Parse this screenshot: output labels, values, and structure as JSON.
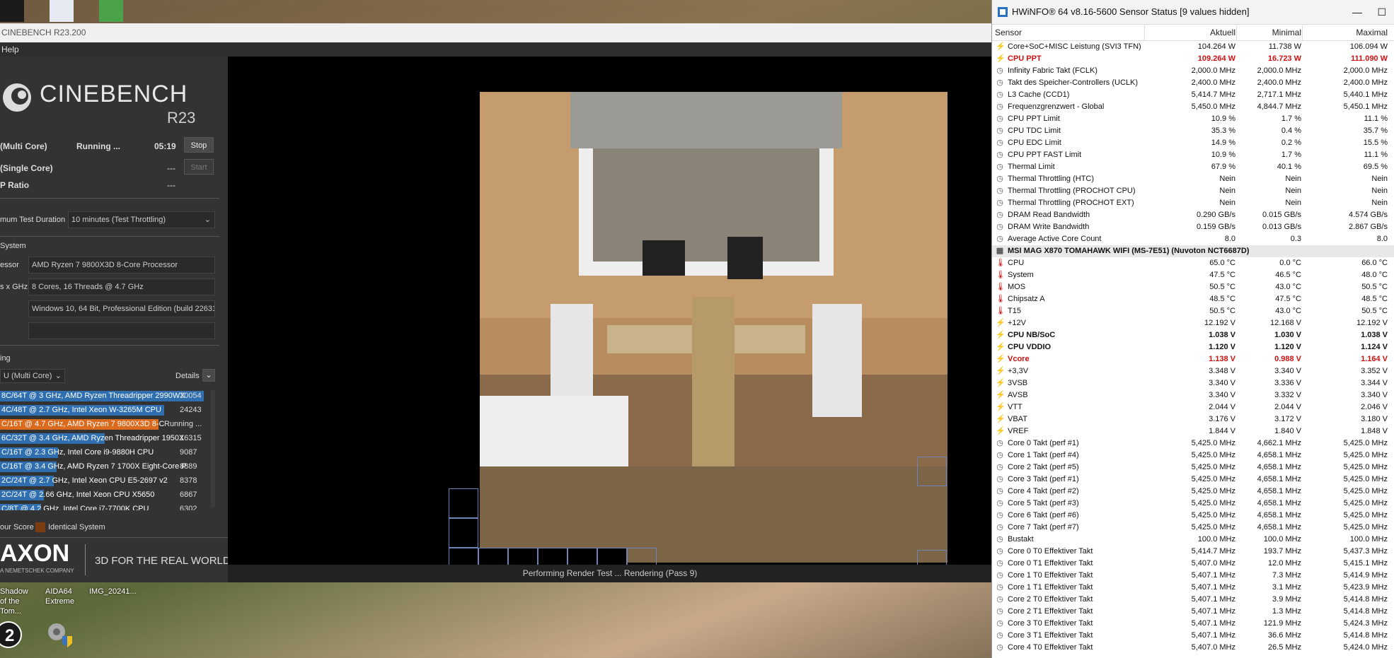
{
  "desktop": {
    "icons": [
      {
        "label": "Shadow of the Tom..."
      },
      {
        "label": "AIDA64 Extreme"
      },
      {
        "label": "IMG_20241..."
      }
    ]
  },
  "cinebench": {
    "title": "CINEBENCH R23.200",
    "menu": {
      "help": "Help"
    },
    "logo": {
      "name": "CINEBENCH",
      "version": "R23"
    },
    "tests": {
      "multi": {
        "label": "(Multi Core)",
        "status": "Running ...",
        "time": "05:19",
        "button": "Stop"
      },
      "single": {
        "label": "(Single Core)",
        "value": "---",
        "button": "Start"
      },
      "ratio": {
        "label": "P Ratio",
        "value": "---"
      }
    },
    "duration": {
      "label": "mum Test Duration",
      "value": "10 minutes (Test Throttling)"
    },
    "system": {
      "heading": "System",
      "processor_label": "essor",
      "processor": "AMD Ryzen 7 9800X3D 8-Core Processor",
      "cores_label": "s x GHz",
      "cores": "8 Cores, 16 Threads @ 4.7 GHz",
      "os": "Windows 10, 64 Bit, Professional Edition (build 22631)",
      "info": ""
    },
    "ranking": {
      "heading": "ing",
      "selector": "U (Multi Core)",
      "details": "Details",
      "rows": [
        {
          "label": "8C/64T @ 3 GHz, AMD Ryzen Threadripper 2990WX",
          "score": "30054",
          "fill": 1.0,
          "type": "other"
        },
        {
          "label": "4C/48T @ 2.7 GHz, Intel Xeon W-3265M CPU",
          "score": "24243",
          "fill": 0.81,
          "type": "other"
        },
        {
          "label": "C/16T @ 4.7 GHz, AMD Ryzen 7 9800X3D 8-C",
          "score": "Running ...",
          "fill": 0.74,
          "type": "mine"
        },
        {
          "label": "6C/32T @ 3.4 GHz, AMD Ryzen Threadripper 1950X",
          "score": "16315",
          "fill": 0.54,
          "type": "other"
        },
        {
          "label": "C/16T @ 2.3 GHz, Intel Core i9-9880H CPU",
          "score": "9087",
          "fill": 0.3,
          "type": "other"
        },
        {
          "label": "C/16T @ 3.4 GHz, AMD Ryzen 7 1700X Eight-Core P",
          "score": "8889",
          "fill": 0.3,
          "type": "other"
        },
        {
          "label": "2C/24T @ 2.7 GHz, Intel Xeon CPU E5-2697 v2",
          "score": "8378",
          "fill": 0.28,
          "type": "other"
        },
        {
          "label": "2C/24T @ 2.66 GHz, Intel Xeon CPU X5650",
          "score": "6867",
          "fill": 0.23,
          "type": "other"
        },
        {
          "label": "C/8T @ 4.2 GHz, Intel Core i7-7700K CPU",
          "score": "6302",
          "fill": 0.21,
          "type": "other"
        }
      ],
      "legend_your": "our Score",
      "legend_identical": "Identical System"
    },
    "footer": {
      "brand": "AXON",
      "sub": "A NEMETSCHEK COMPANY",
      "tagline": "3D FOR THE REAL WORLD"
    },
    "status": "Performing Render Test ... Rendering (Pass 9)"
  },
  "hwinfo": {
    "title": "HWiNFO® 64 v8.16-5600 Sensor Status [9 values hidden]",
    "columns": {
      "sensor": "Sensor",
      "current": "Aktuell",
      "min": "Minimal",
      "max": "Maximal"
    },
    "rows": [
      {
        "icon": "bolt",
        "name": "Core+SoC+MISC Leistung (SVI3 TFN)",
        "v1": "104.264 W",
        "v2": "11.738 W",
        "v3": "106.094 W",
        "style": ""
      },
      {
        "icon": "bolt",
        "name": "CPU PPT",
        "v1": "109.264 W",
        "v2": "16.723 W",
        "v3": "111.090 W",
        "style": "red"
      },
      {
        "icon": "clock",
        "name": "Infinity Fabric Takt (FCLK)",
        "v1": "2,000.0 MHz",
        "v2": "2,000.0 MHz",
        "v3": "2,000.0 MHz",
        "style": ""
      },
      {
        "icon": "clock",
        "name": "Takt des Speicher-Controllers (UCLK)",
        "v1": "2,400.0 MHz",
        "v2": "2,400.0 MHz",
        "v3": "2,400.0 MHz",
        "style": ""
      },
      {
        "icon": "clock",
        "name": "L3 Cache (CCD1)",
        "v1": "5,414.7 MHz",
        "v2": "2,717.1 MHz",
        "v3": "5,440.1 MHz",
        "style": ""
      },
      {
        "icon": "clock",
        "name": "Frequenzgrenzwert - Global",
        "v1": "5,450.0 MHz",
        "v2": "4,844.7 MHz",
        "v3": "5,450.1 MHz",
        "style": ""
      },
      {
        "icon": "clock",
        "name": "CPU PPT Limit",
        "v1": "10.9 %",
        "v2": "1.7 %",
        "v3": "11.1 %",
        "style": ""
      },
      {
        "icon": "clock",
        "name": "CPU TDC Limit",
        "v1": "35.3 %",
        "v2": "0.4 %",
        "v3": "35.7 %",
        "style": ""
      },
      {
        "icon": "clock",
        "name": "CPU EDC Limit",
        "v1": "14.9 %",
        "v2": "0.2 %",
        "v3": "15.5 %",
        "style": ""
      },
      {
        "icon": "clock",
        "name": "CPU PPT FAST Limit",
        "v1": "10.9 %",
        "v2": "1.7 %",
        "v3": "11.1 %",
        "style": ""
      },
      {
        "icon": "clock",
        "name": "Thermal Limit",
        "v1": "67.9 %",
        "v2": "40.1 %",
        "v3": "69.5 %",
        "style": ""
      },
      {
        "icon": "clock",
        "name": "Thermal Throttling (HTC)",
        "v1": "Nein",
        "v2": "Nein",
        "v3": "Nein",
        "style": ""
      },
      {
        "icon": "clock",
        "name": "Thermal Throttling (PROCHOT CPU)",
        "v1": "Nein",
        "v2": "Nein",
        "v3": "Nein",
        "style": ""
      },
      {
        "icon": "clock",
        "name": "Thermal Throttling (PROCHOT EXT)",
        "v1": "Nein",
        "v2": "Nein",
        "v3": "Nein",
        "style": ""
      },
      {
        "icon": "clock",
        "name": "DRAM Read Bandwidth",
        "v1": "0.290 GB/s",
        "v2": "0.015 GB/s",
        "v3": "4.574 GB/s",
        "style": ""
      },
      {
        "icon": "clock",
        "name": "DRAM Write Bandwidth",
        "v1": "0.159 GB/s",
        "v2": "0.013 GB/s",
        "v3": "2.867 GB/s",
        "style": ""
      },
      {
        "icon": "clock",
        "name": "Average Active Core Count",
        "v1": "8.0",
        "v2": "0.3",
        "v3": "8.0",
        "style": ""
      },
      {
        "icon": "chip",
        "name": "MSI MAG X870 TOMAHAWK WIFI (MS-7E51) (Nuvoton NCT6687D)",
        "v1": "",
        "v2": "",
        "v3": "",
        "style": "group"
      },
      {
        "icon": "temp",
        "name": "CPU",
        "v1": "65.0 °C",
        "v2": "0.0 °C",
        "v3": "66.0 °C",
        "style": ""
      },
      {
        "icon": "temp",
        "name": "System",
        "v1": "47.5 °C",
        "v2": "46.5 °C",
        "v3": "48.0 °C",
        "style": ""
      },
      {
        "icon": "temp",
        "name": "MOS",
        "v1": "50.5 °C",
        "v2": "43.0 °C",
        "v3": "50.5 °C",
        "style": ""
      },
      {
        "icon": "temp",
        "name": "Chipsatz A",
        "v1": "48.5 °C",
        "v2": "47.5 °C",
        "v3": "48.5 °C",
        "style": ""
      },
      {
        "icon": "temp",
        "name": "T15",
        "v1": "50.5 °C",
        "v2": "43.0 °C",
        "v3": "50.5 °C",
        "style": ""
      },
      {
        "icon": "bolt",
        "name": "+12V",
        "v1": "12.192 V",
        "v2": "12.168 V",
        "v3": "12.192 V",
        "style": ""
      },
      {
        "icon": "bolt",
        "name": "CPU NB/SoC",
        "v1": "1.038 V",
        "v2": "1.030 V",
        "v3": "1.038 V",
        "style": "bold"
      },
      {
        "icon": "bolt",
        "name": "CPU VDDIO",
        "v1": "1.120 V",
        "v2": "1.120 V",
        "v3": "1.124 V",
        "style": "bold"
      },
      {
        "icon": "bolt",
        "name": "Vcore",
        "v1": "1.138 V",
        "v2": "0.988 V",
        "v3": "1.164 V",
        "style": "red"
      },
      {
        "icon": "bolt",
        "name": "+3,3V",
        "v1": "3.348 V",
        "v2": "3.340 V",
        "v3": "3.352 V",
        "style": ""
      },
      {
        "icon": "bolt",
        "name": "3VSB",
        "v1": "3.340 V",
        "v2": "3.336 V",
        "v3": "3.344 V",
        "style": ""
      },
      {
        "icon": "bolt",
        "name": "AVSB",
        "v1": "3.340 V",
        "v2": "3.332 V",
        "v3": "3.340 V",
        "style": ""
      },
      {
        "icon": "bolt",
        "name": "VTT",
        "v1": "2.044 V",
        "v2": "2.044 V",
        "v3": "2.046 V",
        "style": ""
      },
      {
        "icon": "bolt",
        "name": "VBAT",
        "v1": "3.176 V",
        "v2": "3.172 V",
        "v3": "3.180 V",
        "style": ""
      },
      {
        "icon": "bolt",
        "name": "VREF",
        "v1": "1.844 V",
        "v2": "1.840 V",
        "v3": "1.848 V",
        "style": ""
      },
      {
        "icon": "clock",
        "name": "Core 0 Takt (perf #1)",
        "v1": "5,425.0 MHz",
        "v2": "4,662.1 MHz",
        "v3": "5,425.0 MHz",
        "style": ""
      },
      {
        "icon": "clock",
        "name": "Core 1 Takt (perf #4)",
        "v1": "5,425.0 MHz",
        "v2": "4,658.1 MHz",
        "v3": "5,425.0 MHz",
        "style": ""
      },
      {
        "icon": "clock",
        "name": "Core 2 Takt (perf #5)",
        "v1": "5,425.0 MHz",
        "v2": "4,658.1 MHz",
        "v3": "5,425.0 MHz",
        "style": ""
      },
      {
        "icon": "clock",
        "name": "Core 3 Takt (perf #1)",
        "v1": "5,425.0 MHz",
        "v2": "4,658.1 MHz",
        "v3": "5,425.0 MHz",
        "style": ""
      },
      {
        "icon": "clock",
        "name": "Core 4 Takt (perf #2)",
        "v1": "5,425.0 MHz",
        "v2": "4,658.1 MHz",
        "v3": "5,425.0 MHz",
        "style": ""
      },
      {
        "icon": "clock",
        "name": "Core 5 Takt (perf #3)",
        "v1": "5,425.0 MHz",
        "v2": "4,658.1 MHz",
        "v3": "5,425.0 MHz",
        "style": ""
      },
      {
        "icon": "clock",
        "name": "Core 6 Takt (perf #6)",
        "v1": "5,425.0 MHz",
        "v2": "4,658.1 MHz",
        "v3": "5,425.0 MHz",
        "style": ""
      },
      {
        "icon": "clock",
        "name": "Core 7 Takt (perf #7)",
        "v1": "5,425.0 MHz",
        "v2": "4,658.1 MHz",
        "v3": "5,425.0 MHz",
        "style": ""
      },
      {
        "icon": "clock",
        "name": "Bustakt",
        "v1": "100.0 MHz",
        "v2": "100.0 MHz",
        "v3": "100.0 MHz",
        "style": ""
      },
      {
        "icon": "clock",
        "name": "Core 0 T0 Effektiver Takt",
        "v1": "5,414.7 MHz",
        "v2": "193.7 MHz",
        "v3": "5,437.3 MHz",
        "style": ""
      },
      {
        "icon": "clock",
        "name": "Core 0 T1 Effektiver Takt",
        "v1": "5,407.0 MHz",
        "v2": "12.0 MHz",
        "v3": "5,415.1 MHz",
        "style": ""
      },
      {
        "icon": "clock",
        "name": "Core 1 T0 Effektiver Takt",
        "v1": "5,407.1 MHz",
        "v2": "7.3 MHz",
        "v3": "5,414.9 MHz",
        "style": ""
      },
      {
        "icon": "clock",
        "name": "Core 1 T1 Effektiver Takt",
        "v1": "5,407.1 MHz",
        "v2": "3.1 MHz",
        "v3": "5,423.9 MHz",
        "style": ""
      },
      {
        "icon": "clock",
        "name": "Core 2 T0 Effektiver Takt",
        "v1": "5,407.1 MHz",
        "v2": "3.9 MHz",
        "v3": "5,414.8 MHz",
        "style": ""
      },
      {
        "icon": "clock",
        "name": "Core 2 T1 Effektiver Takt",
        "v1": "5,407.1 MHz",
        "v2": "1.3 MHz",
        "v3": "5,414.8 MHz",
        "style": ""
      },
      {
        "icon": "clock",
        "name": "Core 3 T0 Effektiver Takt",
        "v1": "5,407.1 MHz",
        "v2": "121.9 MHz",
        "v3": "5,424.3 MHz",
        "style": ""
      },
      {
        "icon": "clock",
        "name": "Core 3 T1 Effektiver Takt",
        "v1": "5,407.1 MHz",
        "v2": "36.6 MHz",
        "v3": "5,414.8 MHz",
        "style": ""
      },
      {
        "icon": "clock",
        "name": "Core 4 T0 Effektiver Takt",
        "v1": "5,407.0 MHz",
        "v2": "26.5 MHz",
        "v3": "5,424.0 MHz",
        "style": ""
      }
    ]
  }
}
